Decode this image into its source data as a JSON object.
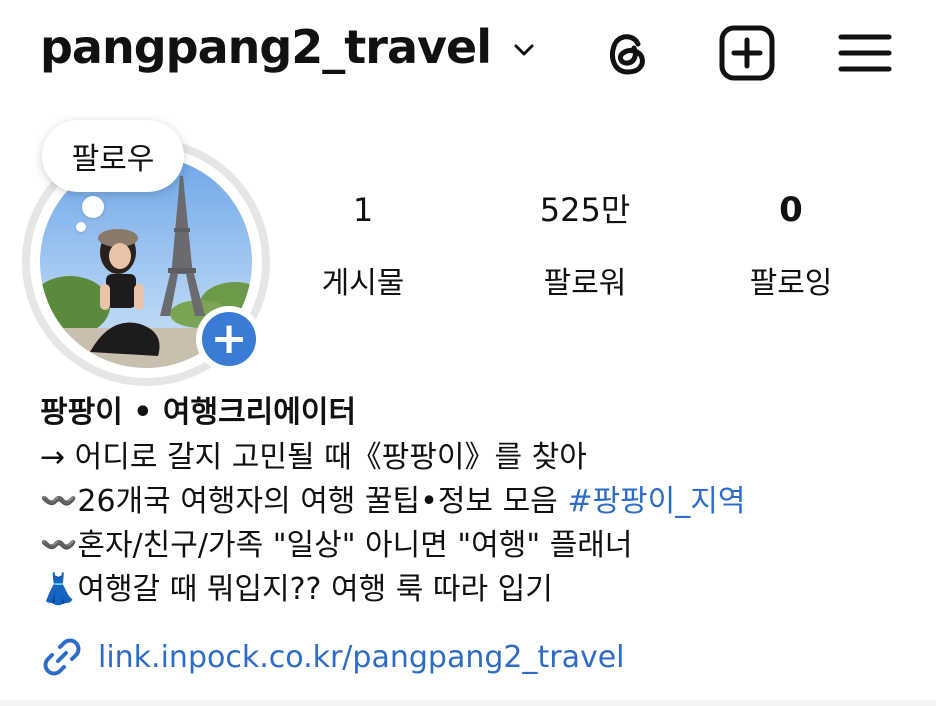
{
  "header": {
    "username": "pangpang2_travel",
    "icons": [
      "chevron-down-icon",
      "threads-icon",
      "new-post-icon",
      "menu-icon"
    ]
  },
  "profile": {
    "note_bubble": "팔로우",
    "add_story_icon": "plus-icon"
  },
  "stats": [
    {
      "value": "1",
      "label": "게시물"
    },
    {
      "value": "525만",
      "label": "팔로워"
    },
    {
      "value": "0",
      "label": "팔로잉"
    }
  ],
  "bio": {
    "name": "팡팡이 • 여행크리에이터",
    "line1": "→ 어디로 갈지 고민될 때《팡팡이》를 찾아",
    "line2_prefix": "〰️26개국 여행자의 여행 꿀팁•정보 모음 ",
    "line2_hashtag": "#팡팡이_지역",
    "line3": "〰️혼자/친구/가족 \"일상\" 아니면 \"여행\" 플래너",
    "line4": "👗여행갈 때 뭐입지?? 여행 룩 따라 입기",
    "link": "link.inpock.co.kr/pangpang2_travel"
  },
  "colors": {
    "link_blue": "#2f6cc7",
    "badge_blue": "#3a7bd5"
  }
}
